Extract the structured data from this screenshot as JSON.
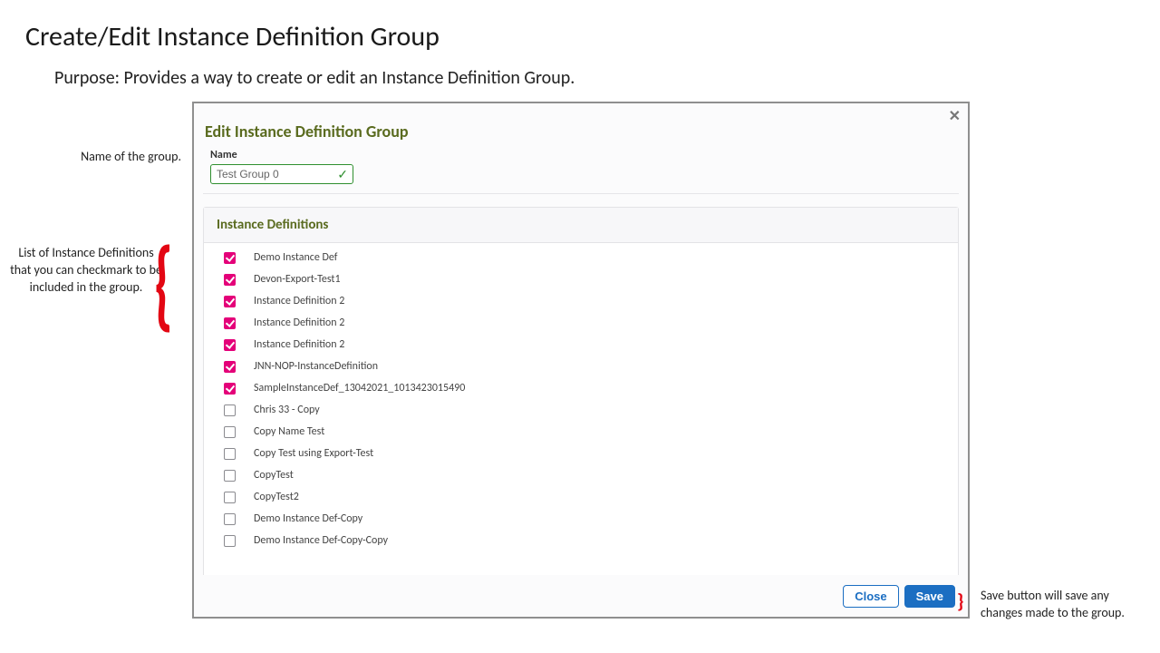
{
  "doc": {
    "title": "Create/Edit Instance Definition Group",
    "purpose": "Purpose: Provides a way to create or edit an Instance Definition Group."
  },
  "annotations": {
    "name": "Name of the group.",
    "list": "List of Instance Definitions that you can checkmark to be included in the group.",
    "save": "Save button will save any changes made to the group."
  },
  "dialog": {
    "title": "Edit Instance Definition Group",
    "close_icon": "✕",
    "name_label": "Name",
    "name_value": "Test Group 0",
    "section_title": "Instance Definitions",
    "buttons": {
      "close": "Close",
      "save": "Save"
    },
    "items": [
      {
        "label": "Demo Instance Def",
        "checked": true
      },
      {
        "label": "Devon-Export-Test1",
        "checked": true
      },
      {
        "label": "Instance Definition 2",
        "checked": true
      },
      {
        "label": "Instance Definition 2",
        "checked": true
      },
      {
        "label": "Instance Definition 2",
        "checked": true
      },
      {
        "label": "JNN-NOP-InstanceDefinition",
        "checked": true
      },
      {
        "label": "SampleInstanceDef_13042021_1013423015490",
        "checked": true
      },
      {
        "label": "Chris 33 - Copy",
        "checked": false
      },
      {
        "label": "Copy Name Test",
        "checked": false
      },
      {
        "label": "Copy Test using Export-Test",
        "checked": false
      },
      {
        "label": "CopyTest",
        "checked": false
      },
      {
        "label": "CopyTest2",
        "checked": false
      },
      {
        "label": "Demo Instance Def-Copy",
        "checked": false
      },
      {
        "label": "Demo Instance Def-Copy-Copy",
        "checked": false
      }
    ]
  }
}
